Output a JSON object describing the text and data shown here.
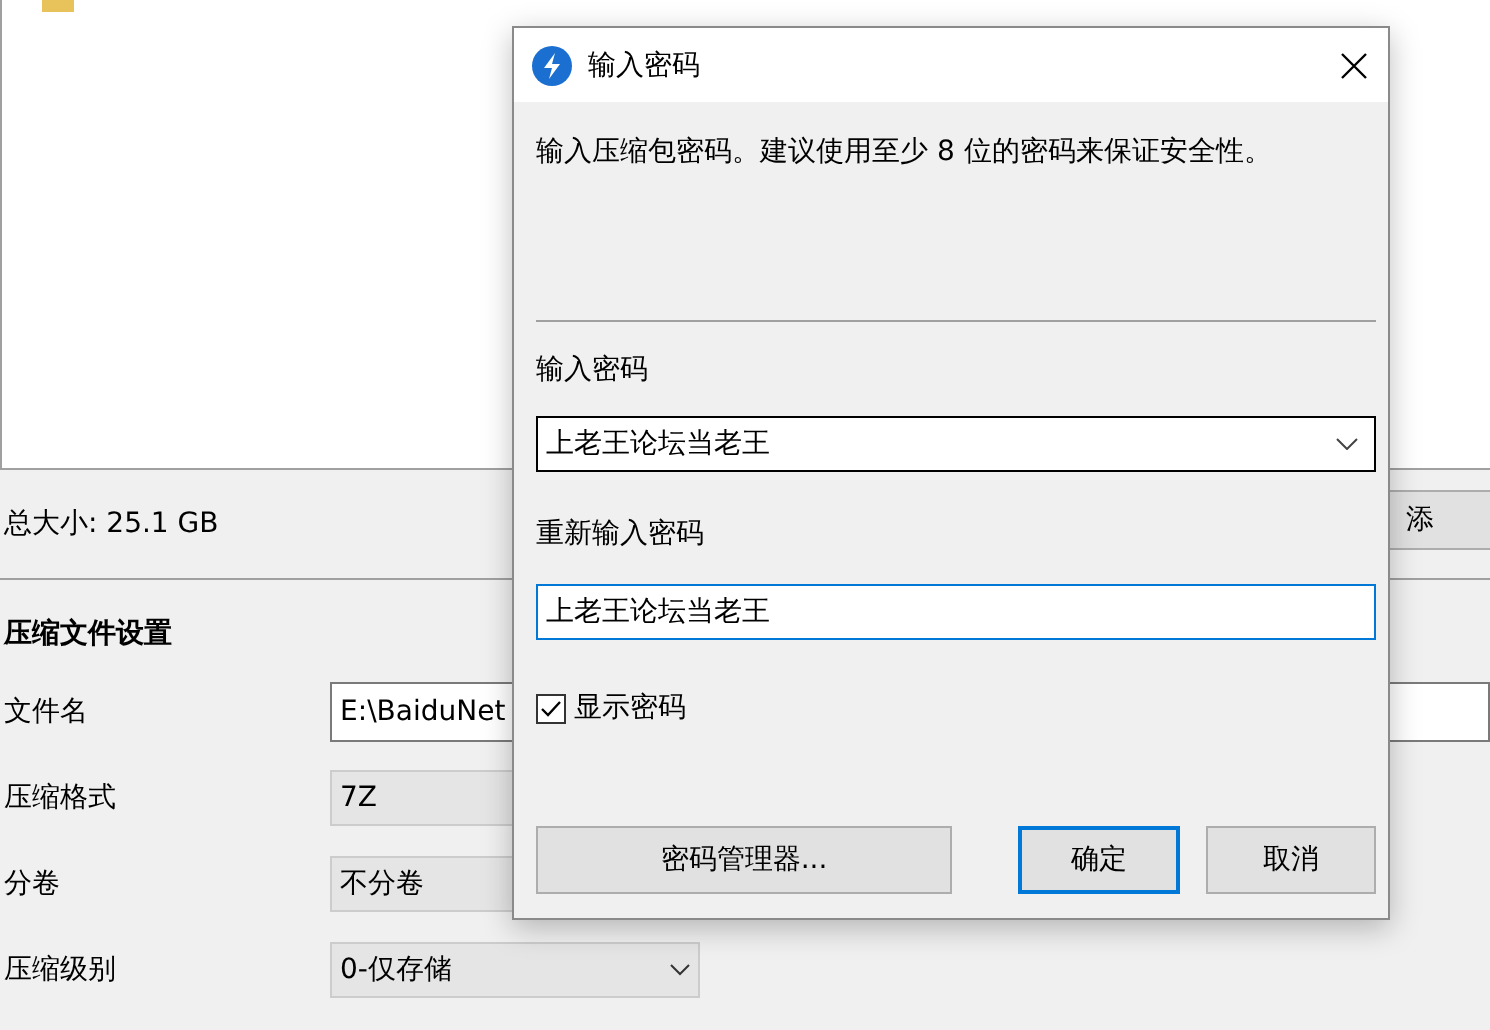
{
  "archive": {
    "total_size": "总大小: 25.1 GB",
    "add_button": "添",
    "settings_title": "压缩文件设置",
    "fields": [
      {
        "kind": "text",
        "label": "文件名",
        "value": "E:\\BaiduNet"
      },
      {
        "kind": "combo",
        "label": "压缩格式",
        "value": "7Z"
      },
      {
        "kind": "combo",
        "label": "分卷",
        "value": "不分卷"
      },
      {
        "kind": "combo",
        "label": "压缩级别",
        "value": "0-仅存储"
      }
    ]
  },
  "dialog": {
    "title": "输入密码",
    "message": "输入压缩包密码。建议使用至少 8 位的密码来保证安全性。",
    "password_label": "输入密码",
    "password_value": "上老王论坛当老王",
    "confirm_label": "重新输入密码",
    "confirm_value": "上老王论坛当老王",
    "show_password": {
      "label": "显示密码",
      "checked": true
    },
    "buttons": [
      {
        "label": "密码管理器...",
        "default": false
      },
      {
        "label": "确定",
        "default": true
      },
      {
        "label": "取消",
        "default": false
      }
    ]
  }
}
